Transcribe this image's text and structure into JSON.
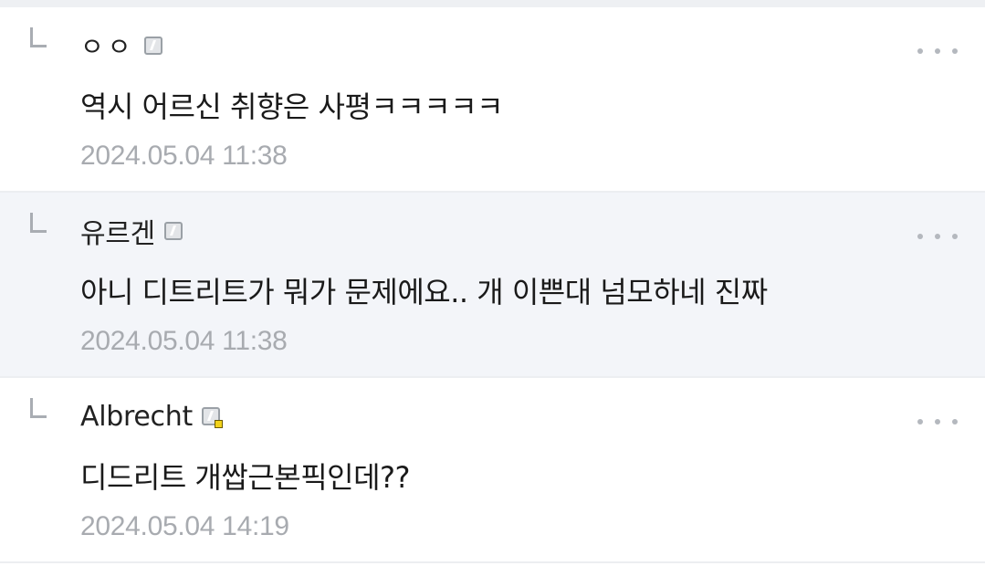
{
  "replies": [
    {
      "author": "ㅇㅇ",
      "text": "역시 어르신 취향은 사평ㅋㅋㅋㅋㅋ",
      "timestamp": "2024.05.04 11:38",
      "highlighted": false,
      "badge": false
    },
    {
      "author": "유르겐",
      "text": "아니 디트리트가 뭐가 문제에요.. 개 이쁜대 넘모하네 진짜",
      "timestamp": "2024.05.04 11:38",
      "highlighted": true,
      "badge": false
    },
    {
      "author": "Albrecht",
      "text": "디드리트 개쌉근본픽인데??",
      "timestamp": "2024.05.04 14:19",
      "highlighted": false,
      "badge": true
    }
  ],
  "icons": {
    "reply_arrow": "reply-arrow-icon",
    "nickname": "fixed-nickname-icon",
    "more": "more-options-icon"
  },
  "colors": {
    "highlight_bg": "#f3f5f9",
    "timestamp": "#a8abb0",
    "badge": "#f2d21b"
  }
}
